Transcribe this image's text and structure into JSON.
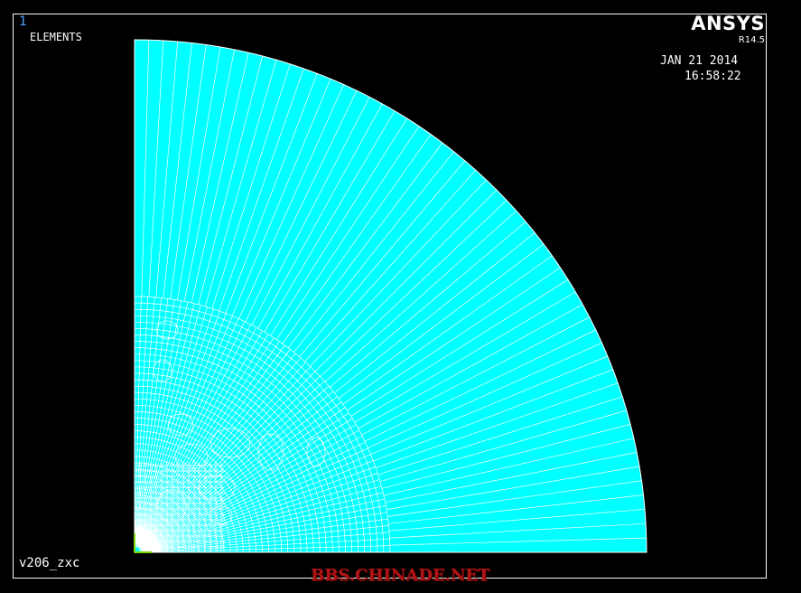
{
  "viewport": {
    "window_number": "1",
    "plot_type": "ELEMENTS",
    "brand": "ANSYS",
    "release": "R14.5",
    "date": "JAN 21 2014",
    "time": "16:58:22",
    "jobname": "v206_zxc"
  },
  "watermark": "BBS.CHINADE.NET",
  "colors": {
    "background": "#000000",
    "element_fill": "#00ffff",
    "element_edges": "#ffffff",
    "frame": "#ffffff",
    "window_number": "#4aa3ff",
    "watermark": "#b01414",
    "triad": "#7cd400"
  },
  "model": {
    "shape": "quarter-disc",
    "outer_radial_divisions": 56,
    "inner_region": "fine free mesh",
    "origin_marker": "triad-icon"
  }
}
